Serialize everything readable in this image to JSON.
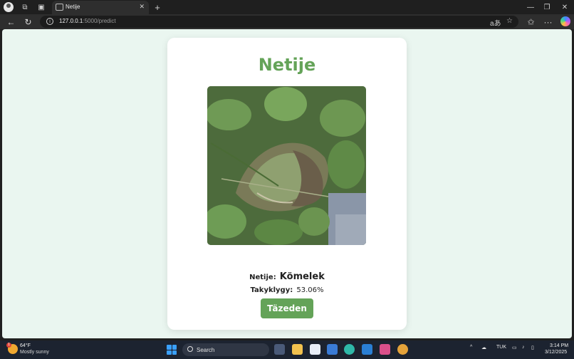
{
  "browser": {
    "tab_title": "Netije",
    "url_host": "127.0.0.1",
    "url_path": ":5000/predict",
    "tab_close_glyph": "✕",
    "new_tab_glyph": "+"
  },
  "page": {
    "title": "Netije",
    "result_label": "Netije:",
    "result_value": "Kömelek",
    "confidence_label": "Takyklygy:",
    "confidence_value": "53.06%",
    "retry_button": "Täzeden",
    "image_alt": "potato leaf with disease",
    "accent_color": "#64a358",
    "page_bg": "#eaf6f0"
  },
  "taskbar": {
    "temperature": "64°F",
    "weather": "Mostly sunny",
    "search_label": "Search",
    "language": "TUK",
    "time": "3:14 PM",
    "date": "3/12/2025"
  }
}
